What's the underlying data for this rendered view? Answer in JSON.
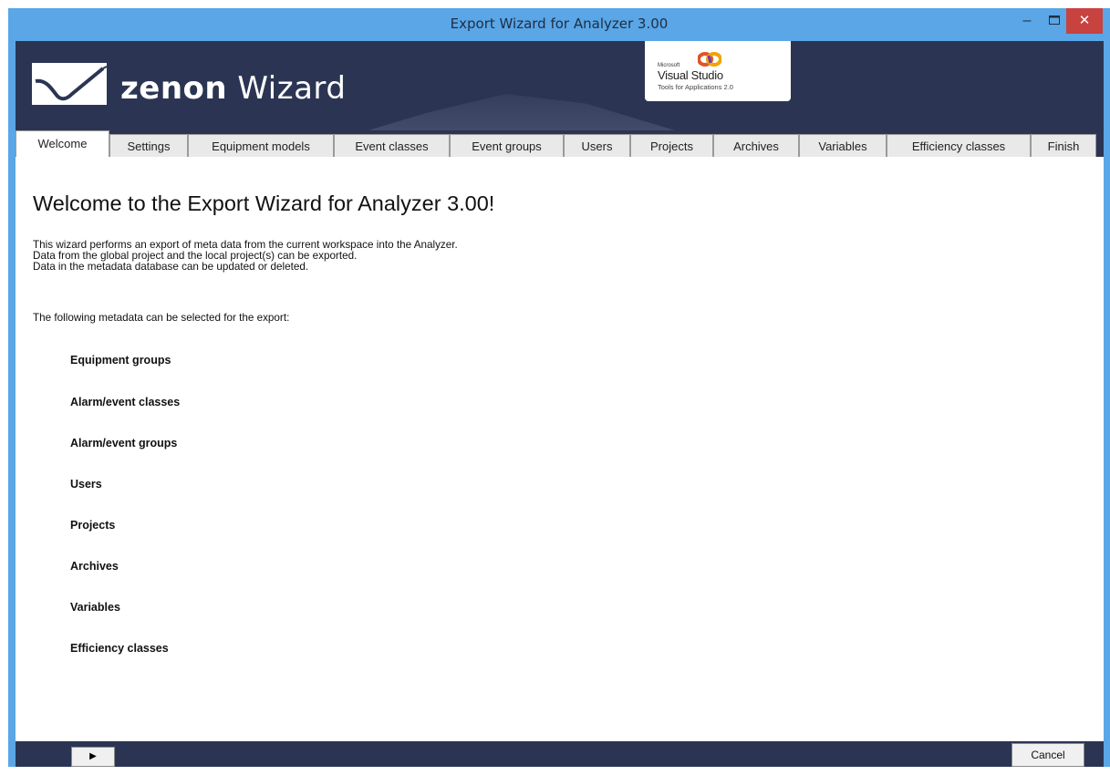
{
  "window": {
    "title": "Export Wizard for Analyzer 3.00",
    "minimize_glyph": "–",
    "maximize_glyph": "▭",
    "close_glyph": "✕",
    "titlebar_color": "#5aa6e6",
    "close_color": "#c8423f"
  },
  "banner": {
    "brand_bold": "zenon",
    "brand_rest": " Wizard",
    "background": "#2b3553",
    "vs_badge": {
      "microsoft": "Microsoft",
      "title": "Visual Studio",
      "subtitle": "Tools for Applications 2.0"
    }
  },
  "tabs": [
    {
      "label": "Welcome",
      "active": true
    },
    {
      "label": "Settings",
      "active": false
    },
    {
      "label": "Equipment models",
      "active": false
    },
    {
      "label": "Event classes",
      "active": false
    },
    {
      "label": "Event groups",
      "active": false
    },
    {
      "label": "Users",
      "active": false
    },
    {
      "label": "Projects",
      "active": false
    },
    {
      "label": "Archives",
      "active": false
    },
    {
      "label": "Variables",
      "active": false
    },
    {
      "label": "Efficiency classes",
      "active": false
    },
    {
      "label": "Finish",
      "active": false
    }
  ],
  "content": {
    "heading": "Welcome to the Export Wizard for Analyzer 3.00!",
    "intro_lines": [
      "This wizard performs an export of meta data from the current workspace into the Analyzer.",
      "Data from the global project and the local project(s) can be exported.",
      "Data in the metadata database can be updated or deleted."
    ],
    "lead": "The following metadata can be selected for the export:",
    "items": [
      "Equipment groups",
      "Alarm/event classes",
      "Alarm/event groups",
      "Users",
      "Projects",
      "Archives",
      "Variables",
      "Efficiency classes"
    ]
  },
  "footer": {
    "play_glyph": "▶",
    "cancel_label": "Cancel"
  }
}
